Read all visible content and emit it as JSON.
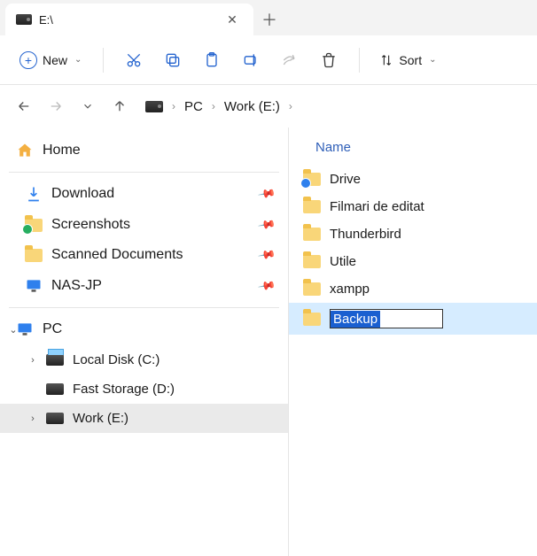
{
  "tab": {
    "title": "E:\\"
  },
  "toolbar": {
    "new_label": "New",
    "sort_label": "Sort"
  },
  "breadcrumb": {
    "root": "PC",
    "drive": "Work (E:)"
  },
  "sidebar": {
    "home": "Home",
    "quick": [
      {
        "label": "Download",
        "icon": "download"
      },
      {
        "label": "Screenshots",
        "icon": "folder-green"
      },
      {
        "label": "Scanned Documents",
        "icon": "folder"
      },
      {
        "label": "NAS-JP",
        "icon": "monitor"
      }
    ],
    "pc_label": "PC",
    "drives": [
      {
        "label": "Local Disk (C:)",
        "icon": "drive-local"
      },
      {
        "label": "Fast Storage (D:)",
        "icon": "drive"
      },
      {
        "label": "Work (E:)",
        "icon": "drive",
        "selected": true
      }
    ]
  },
  "content": {
    "column_name": "Name",
    "items": [
      {
        "label": "Drive",
        "badge": "blue"
      },
      {
        "label": "Filmari de editat"
      },
      {
        "label": "Thunderbird"
      },
      {
        "label": "Utile"
      },
      {
        "label": "xampp"
      }
    ],
    "rename_value": "Backup"
  }
}
